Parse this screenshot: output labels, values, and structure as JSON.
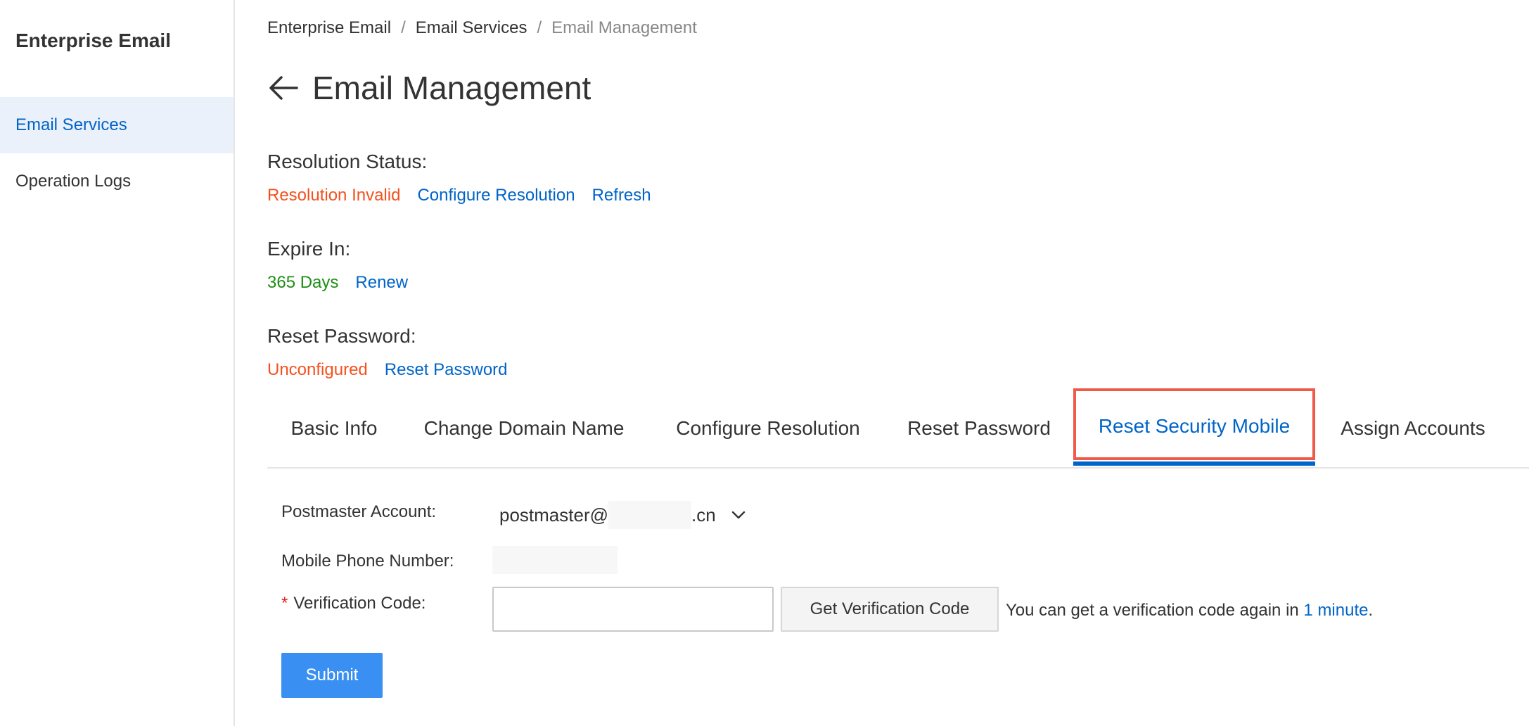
{
  "sidebar": {
    "title": "Enterprise Email",
    "items": [
      {
        "label": "Email Services",
        "active": true
      },
      {
        "label": "Operation Logs",
        "active": false
      }
    ]
  },
  "breadcrumb": [
    "Enterprise Email",
    "Email Services",
    "Email Management"
  ],
  "breadcrumb_separator": "/",
  "page": {
    "title": "Email Management"
  },
  "resolution": {
    "label": "Resolution Status:",
    "status": "Resolution Invalid",
    "configure_link": "Configure Resolution",
    "refresh_link": "Refresh"
  },
  "expire": {
    "label": "Expire In:",
    "value": "365 Days",
    "renew_link": "Renew"
  },
  "reset_password": {
    "label": "Reset Password:",
    "status": "Unconfigured",
    "reset_link": "Reset Password"
  },
  "tabs": [
    {
      "label": "Basic Info"
    },
    {
      "label": "Change Domain Name"
    },
    {
      "label": "Configure Resolution"
    },
    {
      "label": "Reset Password"
    },
    {
      "label": "Reset Security Mobile",
      "active": true
    },
    {
      "label": "Assign Accounts"
    }
  ],
  "form": {
    "postmaster_label": "Postmaster Account:",
    "postmaster_prefix": "postmaster@",
    "postmaster_suffix": ".cn",
    "mobile_label": "Mobile Phone Number:",
    "required_mark": "*",
    "code_label": "Verification Code:",
    "code_value": "",
    "get_code_button": "Get Verification Code",
    "hint_prefix": "You can get a verification code again in ",
    "hint_highlight": "1 minute",
    "hint_suffix": ".",
    "submit_button": "Submit"
  },
  "colors": {
    "primary": "#0064c8",
    "danger": "#f4511e",
    "success": "#1e8e13",
    "highlight_box": "#ef5a4a",
    "submit": "#3a8ff2"
  },
  "icons": {
    "back": "arrow-left-icon",
    "dropdown": "chevron-down-icon"
  }
}
